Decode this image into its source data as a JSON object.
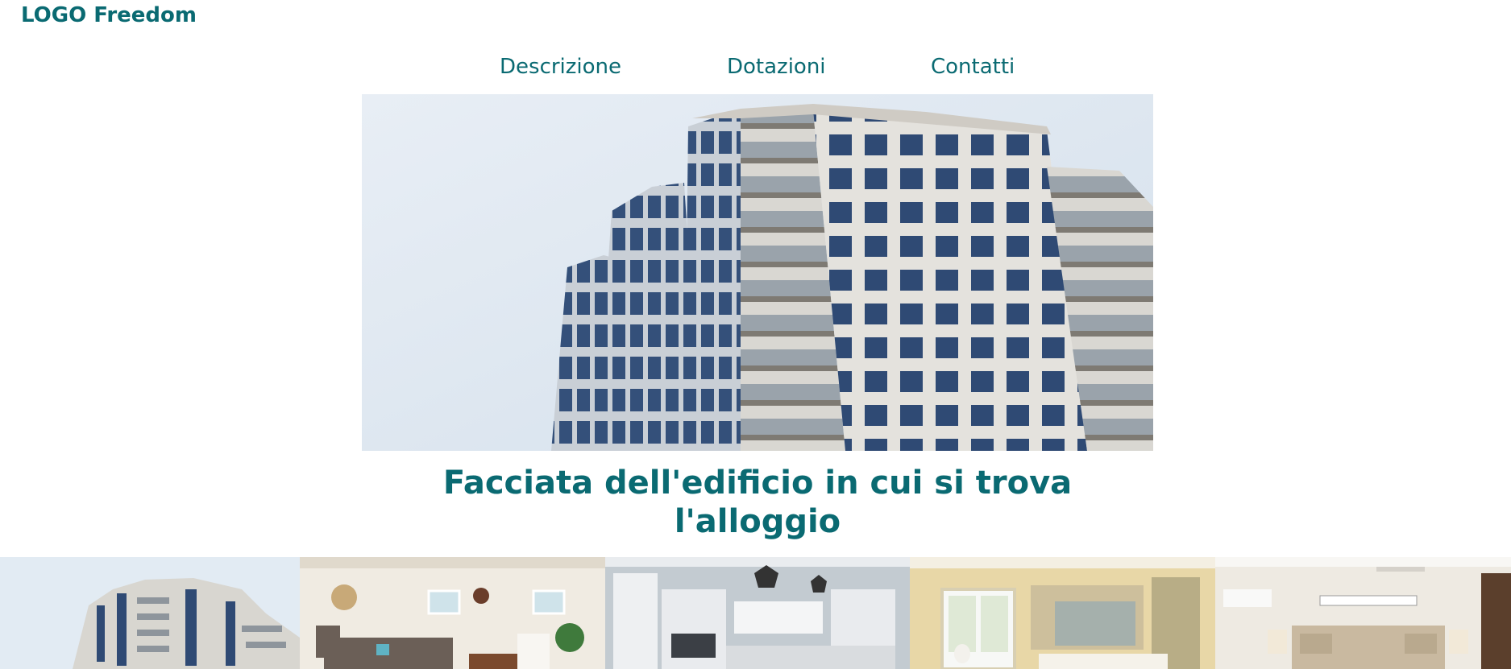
{
  "header": {
    "logo_text": "LOGO Freedom"
  },
  "nav": {
    "items": [
      {
        "label": "Descrizione"
      },
      {
        "label": "Dotazioni"
      },
      {
        "label": "Contatti"
      }
    ]
  },
  "main": {
    "caption": "Facciata dell'edificio in cui si trova l'alloggio"
  },
  "colors": {
    "brand": "#0a6a72",
    "background": "#ffffff"
  }
}
